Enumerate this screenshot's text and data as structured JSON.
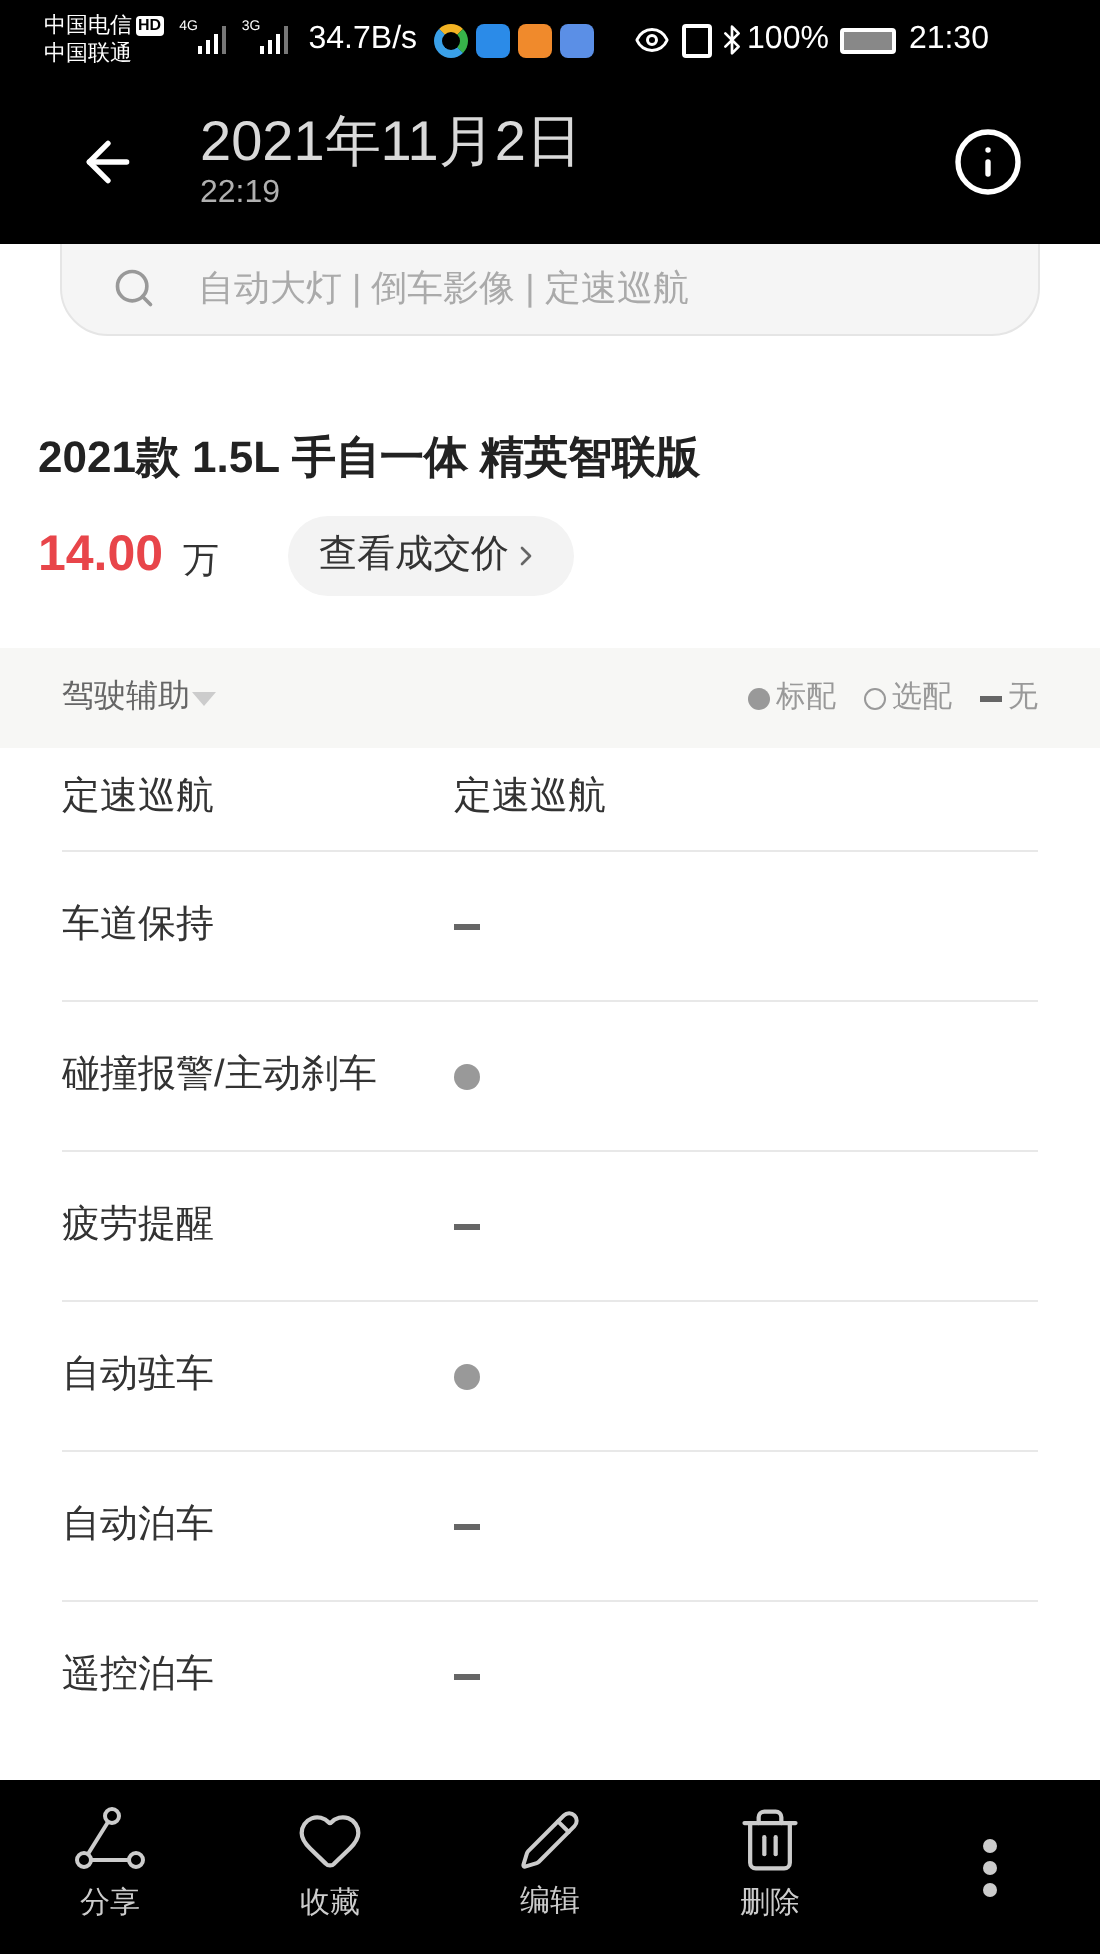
{
  "status_bar": {
    "carrier_1": "中国电信",
    "hd": "HD",
    "carrier_2": "中国联通",
    "net_1": "4G",
    "net_2": "3G",
    "speed": "34.7B/s",
    "battery": "100%",
    "time": "21:30"
  },
  "header": {
    "title": "2021年11月2日",
    "subtitle": "22:19"
  },
  "search": {
    "placeholder": "自动大灯 | 倒车影像 | 定速巡航"
  },
  "model": {
    "name": "2021款 1.5L 手自一体 精英智联版",
    "price": "14.00",
    "unit": "万",
    "deal_button": "查看成交价"
  },
  "section": {
    "title": "驾驶辅助",
    "legend": [
      {
        "kind": "standard",
        "label": "标配"
      },
      {
        "kind": "optional",
        "label": "选配"
      },
      {
        "kind": "none",
        "label": "无"
      }
    ]
  },
  "rows": [
    {
      "name": "定速巡航",
      "kind": "text",
      "value": "定速巡航"
    },
    {
      "name": "车道保持",
      "kind": "none"
    },
    {
      "name": "碰撞报警/主动刹车",
      "kind": "standard"
    },
    {
      "name": "疲劳提醒",
      "kind": "none"
    },
    {
      "name": "自动驻车",
      "kind": "standard"
    },
    {
      "name": "自动泊车",
      "kind": "none"
    },
    {
      "name": "遥控泊车",
      "kind": "none"
    }
  ],
  "toolbar": [
    {
      "kind": "share",
      "label": "分享"
    },
    {
      "kind": "favorite",
      "label": "收藏"
    },
    {
      "kind": "edit",
      "label": "编辑"
    },
    {
      "kind": "delete",
      "label": "删除"
    },
    {
      "kind": "more"
    }
  ]
}
